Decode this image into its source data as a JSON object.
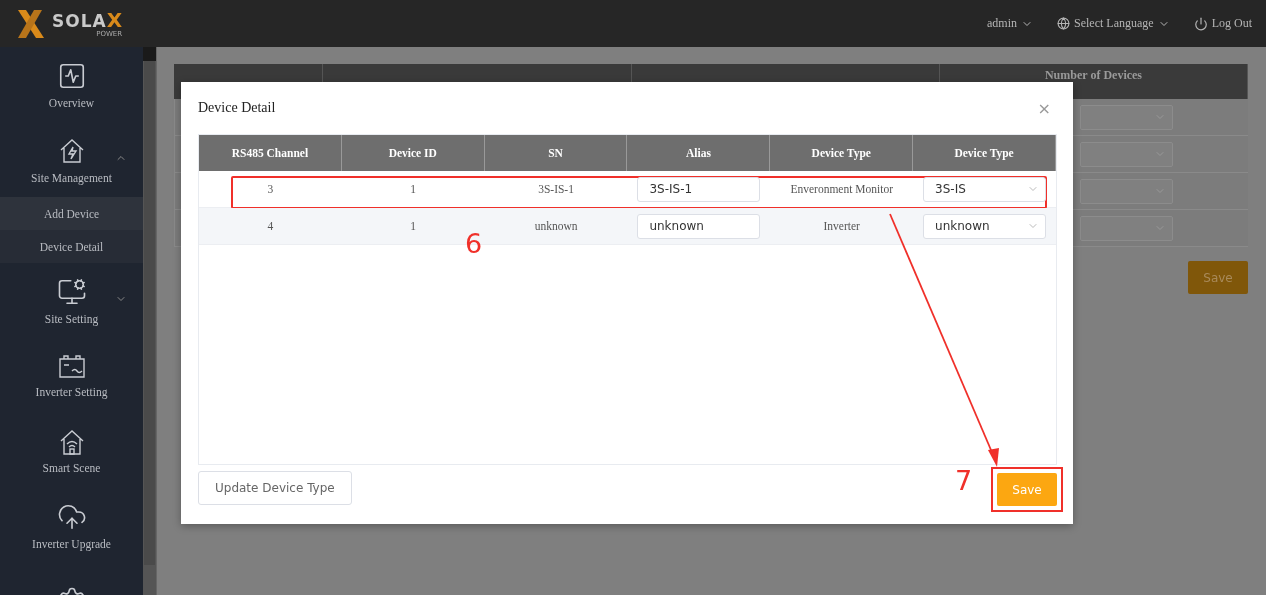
{
  "header": {
    "logo": {
      "word": "SOLA",
      "accent": "X",
      "sub": "POWER"
    },
    "user": "admin",
    "language": "Select Language",
    "logout": "Log Out"
  },
  "sidebar": {
    "items": [
      {
        "kind": "link",
        "label": "Overview"
      },
      {
        "kind": "group",
        "label": "Site Management",
        "expanded": true,
        "children": [
          {
            "label": "Add Device",
            "selected": true
          },
          {
            "label": "Device Detail",
            "selected": false
          }
        ]
      },
      {
        "kind": "group",
        "label": "Site Setting",
        "expanded": false
      },
      {
        "kind": "link",
        "label": "Inverter Setting"
      },
      {
        "kind": "link",
        "label": "Smart Scene"
      },
      {
        "kind": "link",
        "label": "Inverter Upgrade"
      },
      {
        "kind": "link"
      }
    ]
  },
  "background_table": {
    "columns": [
      {},
      {},
      {},
      {
        "label": "Number of Devices"
      }
    ],
    "rows": [
      {
        "kind": "select"
      },
      {
        "kind": "select"
      },
      {
        "kind": "select"
      },
      {
        "kind": "select"
      }
    ],
    "save": "Save"
  },
  "modal": {
    "title": "Device Detail",
    "close": "×",
    "columns": [
      "RS485 Channel",
      "Device ID",
      "SN",
      "Alias",
      "Device Type",
      "Device Type"
    ],
    "rows": [
      {
        "channel": "3",
        "device_id": "1",
        "sn": "3S-IS-1",
        "alias": "3S-IS-1",
        "type": "Enveronment Monitor",
        "model": "3S-IS",
        "highlighted": true
      },
      {
        "channel": "4",
        "device_id": "1",
        "sn": "unknown",
        "alias": "unknown",
        "type": "Inverter",
        "model": "unknown",
        "highlighted": false
      }
    ],
    "update_button": "Update Device Type",
    "save_button": {
      "label": "Save",
      "highlighted": true
    },
    "annotations": [
      {
        "label": "6"
      },
      {
        "label": "7"
      }
    ]
  }
}
